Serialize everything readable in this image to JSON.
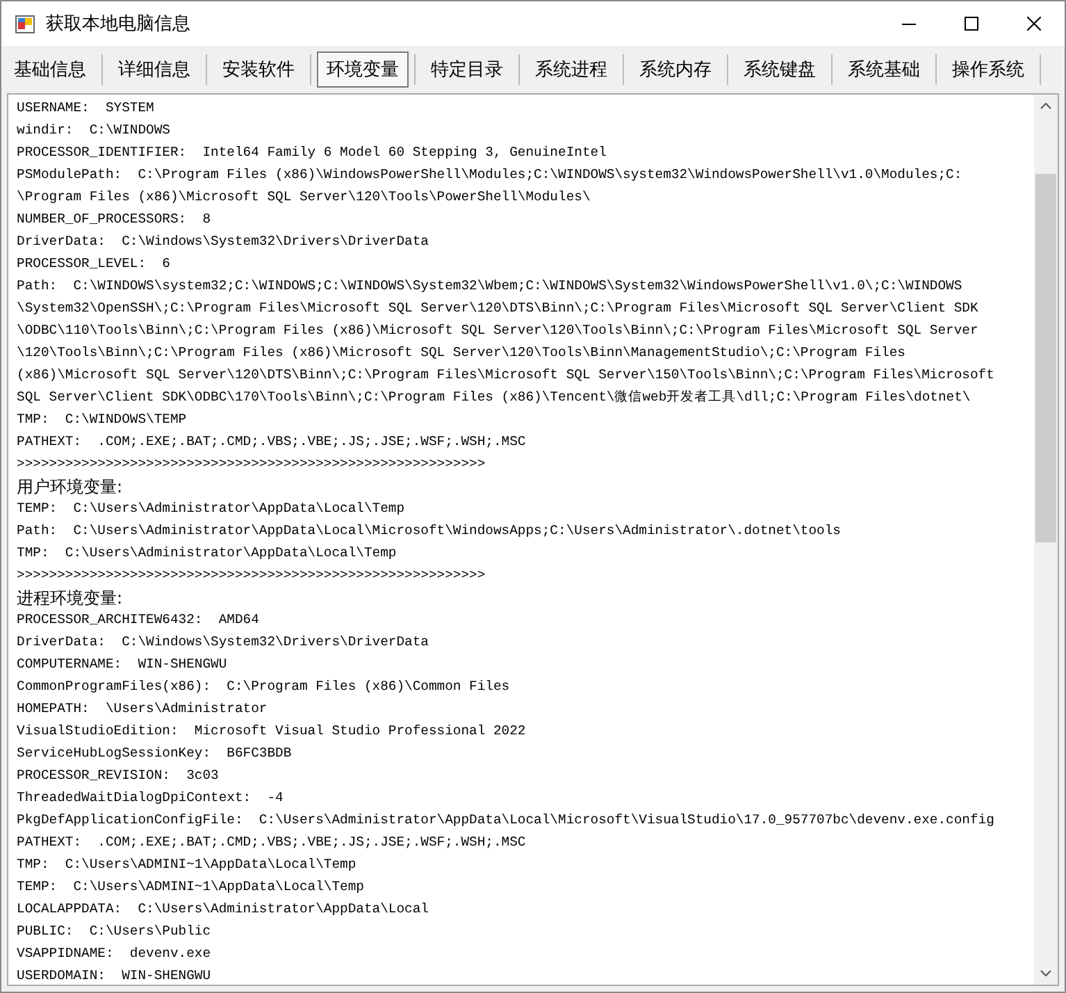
{
  "window": {
    "title": "获取本地电脑信息"
  },
  "tabs": [
    {
      "label": "基础信息",
      "selected": false
    },
    {
      "label": "详细信息",
      "selected": false
    },
    {
      "label": "安装软件",
      "selected": false
    },
    {
      "label": "环境变量",
      "selected": true
    },
    {
      "label": "特定目录",
      "selected": false
    },
    {
      "label": "系统进程",
      "selected": false
    },
    {
      "label": "系统内存",
      "selected": false
    },
    {
      "label": "系统键盘",
      "selected": false
    },
    {
      "label": "系统基础",
      "selected": false
    },
    {
      "label": "操作系统",
      "selected": false
    }
  ],
  "lines": [
    {
      "kind": "text",
      "text": "USERNAME:  SYSTEM"
    },
    {
      "kind": "text",
      "text": "windir:  C:\\WINDOWS"
    },
    {
      "kind": "text",
      "text": "PROCESSOR_IDENTIFIER:  Intel64 Family 6 Model 60 Stepping 3, GenuineIntel"
    },
    {
      "kind": "text",
      "text": "PSModulePath:  C:\\Program Files (x86)\\WindowsPowerShell\\Modules;C:\\WINDOWS\\system32\\WindowsPowerShell\\v1.0\\Modules;C:"
    },
    {
      "kind": "text",
      "text": "\\Program Files (x86)\\Microsoft SQL Server\\120\\Tools\\PowerShell\\Modules\\"
    },
    {
      "kind": "text",
      "text": "NUMBER_OF_PROCESSORS:  8"
    },
    {
      "kind": "text",
      "text": "DriverData:  C:\\Windows\\System32\\Drivers\\DriverData"
    },
    {
      "kind": "text",
      "text": "PROCESSOR_LEVEL:  6"
    },
    {
      "kind": "text",
      "text": "Path:  C:\\WINDOWS\\system32;C:\\WINDOWS;C:\\WINDOWS\\System32\\Wbem;C:\\WINDOWS\\System32\\WindowsPowerShell\\v1.0\\;C:\\WINDOWS"
    },
    {
      "kind": "text",
      "text": "\\System32\\OpenSSH\\;C:\\Program Files\\Microsoft SQL Server\\120\\DTS\\Binn\\;C:\\Program Files\\Microsoft SQL Server\\Client SDK"
    },
    {
      "kind": "text",
      "text": "\\ODBC\\110\\Tools\\Binn\\;C:\\Program Files (x86)\\Microsoft SQL Server\\120\\Tools\\Binn\\;C:\\Program Files\\Microsoft SQL Server"
    },
    {
      "kind": "text",
      "text": "\\120\\Tools\\Binn\\;C:\\Program Files (x86)\\Microsoft SQL Server\\120\\Tools\\Binn\\ManagementStudio\\;C:\\Program Files"
    },
    {
      "kind": "text",
      "text": "(x86)\\Microsoft SQL Server\\120\\DTS\\Binn\\;C:\\Program Files\\Microsoft SQL Server\\150\\Tools\\Binn\\;C:\\Program Files\\Microsoft"
    },
    {
      "kind": "text",
      "text": "SQL Server\\Client SDK\\ODBC\\170\\Tools\\Binn\\;C:\\Program Files (x86)\\Tencent\\微信web开发者工具\\dll;C:\\Program Files\\dotnet\\"
    },
    {
      "kind": "text",
      "text": "TMP:  C:\\WINDOWS\\TEMP"
    },
    {
      "kind": "text",
      "text": "PATHEXT:  .COM;.EXE;.BAT;.CMD;.VBS;.VBE;.JS;.JSE;.WSF;.WSH;.MSC"
    },
    {
      "kind": "text",
      "text": ">>>>>>>>>>>>>>>>>>>>>>>>>>>>>>>>>>>>>>>>>>>>>>>>>>>>>>>>>>"
    },
    {
      "kind": "heading",
      "text": "用户环境变量:"
    },
    {
      "kind": "text",
      "text": "TEMP:  C:\\Users\\Administrator\\AppData\\Local\\Temp"
    },
    {
      "kind": "text",
      "text": "Path:  C:\\Users\\Administrator\\AppData\\Local\\Microsoft\\WindowsApps;C:\\Users\\Administrator\\.dotnet\\tools"
    },
    {
      "kind": "text",
      "text": "TMP:  C:\\Users\\Administrator\\AppData\\Local\\Temp"
    },
    {
      "kind": "text",
      "text": ">>>>>>>>>>>>>>>>>>>>>>>>>>>>>>>>>>>>>>>>>>>>>>>>>>>>>>>>>>"
    },
    {
      "kind": "heading",
      "text": "进程环境变量:"
    },
    {
      "kind": "text",
      "text": "PROCESSOR_ARCHITEW6432:  AMD64"
    },
    {
      "kind": "text",
      "text": "DriverData:  C:\\Windows\\System32\\Drivers\\DriverData"
    },
    {
      "kind": "text",
      "text": "COMPUTERNAME:  WIN-SHENGWU"
    },
    {
      "kind": "text",
      "text": "CommonProgramFiles(x86):  C:\\Program Files (x86)\\Common Files"
    },
    {
      "kind": "text",
      "text": "HOMEPATH:  \\Users\\Administrator"
    },
    {
      "kind": "text",
      "text": "VisualStudioEdition:  Microsoft Visual Studio Professional 2022"
    },
    {
      "kind": "text",
      "text": "ServiceHubLogSessionKey:  B6FC3BDB"
    },
    {
      "kind": "text",
      "text": "PROCESSOR_REVISION:  3c03"
    },
    {
      "kind": "text",
      "text": "ThreadedWaitDialogDpiContext:  -4"
    },
    {
      "kind": "text",
      "text": "PkgDefApplicationConfigFile:  C:\\Users\\Administrator\\AppData\\Local\\Microsoft\\VisualStudio\\17.0_957707bc\\devenv.exe.config"
    },
    {
      "kind": "text",
      "text": "PATHEXT:  .COM;.EXE;.BAT;.CMD;.VBS;.VBE;.JS;.JSE;.WSF;.WSH;.MSC"
    },
    {
      "kind": "text",
      "text": "TMP:  C:\\Users\\ADMINI~1\\AppData\\Local\\Temp"
    },
    {
      "kind": "text",
      "text": "TEMP:  C:\\Users\\ADMINI~1\\AppData\\Local\\Temp"
    },
    {
      "kind": "text",
      "text": "LOCALAPPDATA:  C:\\Users\\Administrator\\AppData\\Local"
    },
    {
      "kind": "text",
      "text": "PUBLIC:  C:\\Users\\Public"
    },
    {
      "kind": "text",
      "text": "VSAPPIDNAME:  devenv.exe"
    },
    {
      "kind": "text",
      "text": "USERDOMAIN:  WIN-SHENGWU"
    }
  ]
}
